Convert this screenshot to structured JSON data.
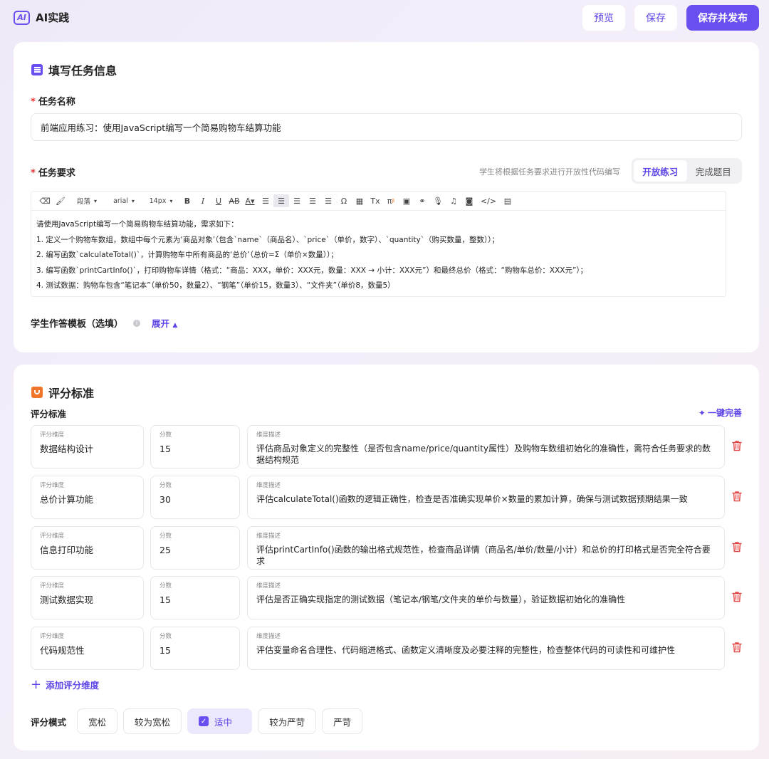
{
  "app": {
    "logo_badge": "AI",
    "title": "AI实践"
  },
  "toolbar": {
    "preview": "预览",
    "save": "保存",
    "save_publish": "保存并发布"
  },
  "task": {
    "section_title": "填写任务信息",
    "name_label": "任务名称",
    "name_value": "前端应用练习：使用JavaScript编写一个简易购物车结算功能",
    "req_label": "任务要求",
    "req_hint": "学生将根据任务要求进行开放性代码编写",
    "modes": [
      "开放练习",
      "完成题目"
    ],
    "editor_toolbar": {
      "paragraph": "段落",
      "font": "arial",
      "size": "14px"
    },
    "requirements": [
      "请使用JavaScript编写一个简易购物车结算功能，需求如下：",
      "1. 定义一个购物车数组，数组中每个元素为‘商品对象’（包含`name`（商品名）、`price`（单价，数字）、`quantity`（购买数量，整数））；",
      "2. 编写函数`calculateTotal()`，计算购物车中所有商品的‘总价’（总价=Σ（单价×数量））；",
      "3. 编写函数`printCartInfo()`，打印购物车详情（格式：“商品：XXX，单价：XXX元，数量：XXX → 小计：XXX元”）和最终总价（格式：“购物车总价：XXX元”）；",
      "4. 测试数据：购物车包含“笔记本”（单价50，数量2）、“钢笔”（单价15，数量3）、“文件夹”（单价8，数量5）"
    ],
    "template_label": "学生作答模板（选填）",
    "template_toggle": "展开"
  },
  "scoring": {
    "section_title": "评分标准",
    "sub_label": "评分标准",
    "auto_complete": "一键完善",
    "dim_label": "评分维度",
    "score_label": "分数",
    "desc_label": "维度描述",
    "criteria": [
      {
        "dimension": "数据结构设计",
        "score": "15",
        "description": "评估商品对象定义的完整性（是否包含name/price/quantity属性）及购物车数组初始化的准确性，需符合任务要求的数据结构规范"
      },
      {
        "dimension": "总价计算功能",
        "score": "30",
        "description": "评估calculateTotal()函数的逻辑正确性，检查是否准确实现单价×数量的累加计算，确保与测试数据预期结果一致"
      },
      {
        "dimension": "信息打印功能",
        "score": "25",
        "description": "评估printCartInfo()函数的输出格式规范性，检查商品详情（商品名/单价/数量/小计）和总价的打印格式是否完全符合要求"
      },
      {
        "dimension": "测试数据实现",
        "score": "15",
        "description": "评估是否正确实现指定的测试数据（笔记本/钢笔/文件夹的单价与数量），验证数据初始化的准确性"
      },
      {
        "dimension": "代码规范性",
        "score": "15",
        "description": "评估变量命名合理性、代码缩进格式、函数定义清晰度及必要注释的完整性，检查整体代码的可读性和可维护性"
      }
    ],
    "add_dimension": "添加评分维度",
    "mode_label": "评分模式",
    "mode_options": [
      "宽松",
      "较为宽松",
      "适中",
      "较为严苛",
      "严苛"
    ],
    "mode_selected": "适中"
  },
  "colors": {
    "accent": "#6a4ff0",
    "danger": "#e33",
    "orange": "#f0742a"
  }
}
